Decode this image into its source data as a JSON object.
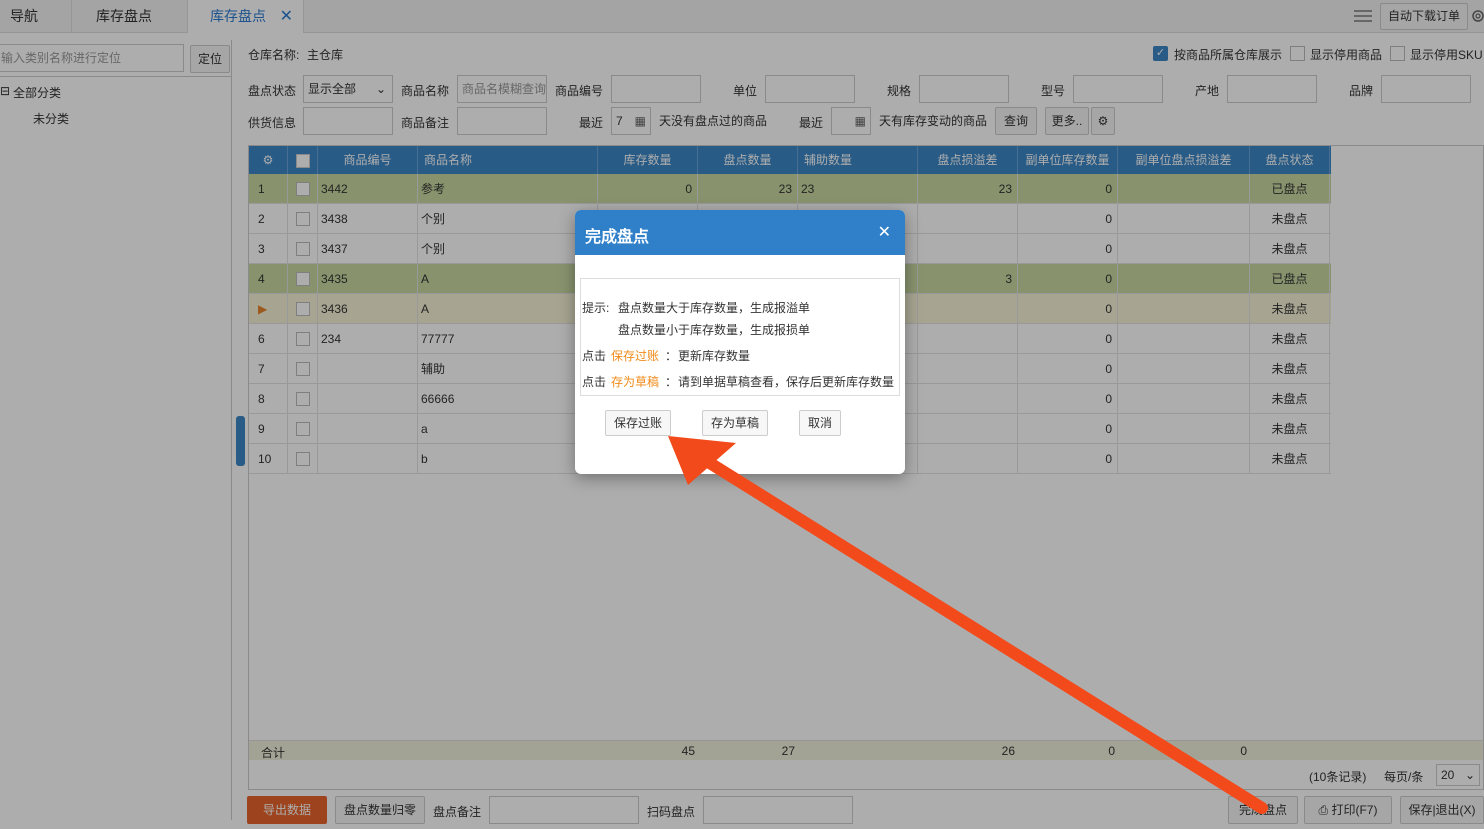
{
  "tabs": {
    "nav": "导航",
    "stock_check": "库存盘点",
    "stock_check_active": "库存盘点",
    "close": "✕"
  },
  "topright": {
    "auto_download": "自动下载订单"
  },
  "left": {
    "search_placeholder": "输入类别名称进行定位",
    "locate_btn": "定位",
    "all_category": "全部分类",
    "uncategorized": "未分类",
    "tree_toggle": "⊟"
  },
  "filters": {
    "warehouse_label": "仓库名称:",
    "warehouse_value": "主仓库",
    "chk_by_warehouse": "按商品所属仓库展示",
    "chk_show_disabled_goods": "显示停用商品",
    "chk_show_disabled_sku": "显示停用SKU",
    "status_label": "盘点状态",
    "status_value": "显示全部",
    "name_label": "商品名称",
    "name_placeholder": "商品名模糊查询",
    "code_label": "商品编号",
    "unit_label": "单位",
    "spec_label": "规格",
    "model_label": "型号",
    "origin_label": "产地",
    "brand_label": "品牌",
    "supply_label": "供货信息",
    "remark_label": "商品备注",
    "recent_label": "最近",
    "recent_days": "7",
    "no_check_text": "天没有盘点过的商品",
    "recent2_label": "最近",
    "stock_change_text": "天有库存变动的商品",
    "query_btn": "查询",
    "more_btn": "更多.."
  },
  "grid": {
    "headers": [
      "商品编号",
      "商品名称",
      "库存数量",
      "盘点数量",
      "辅助数量",
      "盘点损溢差",
      "副单位库存数量",
      "副单位盘点损溢差",
      "盘点状态"
    ],
    "rows": [
      {
        "idx": "1",
        "code": "3442",
        "name": "参考",
        "stock": "0",
        "check": "23",
        "aux": "23",
        "diff": "23",
        "sub_stock": "0",
        "sub_diff": "",
        "status": "已盘点",
        "hl": "green"
      },
      {
        "idx": "2",
        "code": "3438",
        "name": "个别",
        "stock": "",
        "check": "",
        "aux": "",
        "diff": "",
        "sub_stock": "0",
        "sub_diff": "",
        "status": "未盘点",
        "hl": ""
      },
      {
        "idx": "3",
        "code": "3437",
        "name": "个别",
        "stock": "",
        "check": "",
        "aux": "",
        "diff": "",
        "sub_stock": "0",
        "sub_diff": "",
        "status": "未盘点",
        "hl": ""
      },
      {
        "idx": "4",
        "code": "3435",
        "name": "A",
        "stock": "",
        "check": "",
        "aux": "",
        "diff": "3",
        "sub_stock": "0",
        "sub_diff": "",
        "status": "已盘点",
        "hl": "green"
      },
      {
        "idx": "▶",
        "code": "3436",
        "name": "A",
        "stock": "",
        "check": "",
        "aux": "",
        "diff": "",
        "sub_stock": "0",
        "sub_diff": "",
        "status": "未盘点",
        "hl": "yellow"
      },
      {
        "idx": "6",
        "code": "234",
        "name": "77777",
        "stock": "",
        "check": "",
        "aux": "",
        "diff": "",
        "sub_stock": "0",
        "sub_diff": "",
        "status": "未盘点",
        "hl": ""
      },
      {
        "idx": "7",
        "code": "",
        "name": "辅助",
        "stock": "",
        "check": "",
        "aux": "",
        "diff": "",
        "sub_stock": "0",
        "sub_diff": "",
        "status": "未盘点",
        "hl": ""
      },
      {
        "idx": "8",
        "code": "",
        "name": "66666",
        "stock": "",
        "check": "",
        "aux": "",
        "diff": "",
        "sub_stock": "0",
        "sub_diff": "",
        "status": "未盘点",
        "hl": ""
      },
      {
        "idx": "9",
        "code": "",
        "name": "a",
        "stock": "",
        "check": "",
        "aux": "",
        "diff": "",
        "sub_stock": "0",
        "sub_diff": "",
        "status": "未盘点",
        "hl": ""
      },
      {
        "idx": "10",
        "code": "",
        "name": "b",
        "stock": "",
        "check": "",
        "aux": "",
        "diff": "",
        "sub_stock": "0",
        "sub_diff": "",
        "status": "未盘点",
        "hl": ""
      }
    ],
    "total_label": "合计",
    "total_stock": "45",
    "total_check": "27",
    "total_diff": "26",
    "total_sub_stock": "0",
    "total_sub_diff": "0",
    "records": "(10条记录)",
    "per_page_label": "每页/条",
    "per_page": "20"
  },
  "bottom": {
    "export_btn": "导出数据",
    "zero_btn": "盘点数量归零",
    "remark_label": "盘点备注",
    "scan_label": "扫码盘点",
    "finish_btn": "完成盘点",
    "print_btn": "打印(F7)",
    "save_exit_btn": "保存|退出(X)"
  },
  "dialog": {
    "title": "完成盘点",
    "close": "✕",
    "tip_prefix": "提示:",
    "tip1": "盘点数量大于库存数量，生成报溢单",
    "tip2": "盘点数量小于库存数量，生成报损单",
    "click1": "点击",
    "save_post": "保存过账",
    "colon1": "：",
    "desc1": "更新库存数量",
    "click2": "点击",
    "save_draft": "存为草稿",
    "colon2": "：",
    "desc2": "请到单据草稿查看，保存后更新库存数量",
    "btn_post": "保存过账",
    "btn_draft": "存为草稿",
    "btn_cancel": "取消"
  },
  "colors": {
    "header_blue": "#3c86c6",
    "dialog_blue": "#2f80c9",
    "export_orange": "#e8652f",
    "arrow": "#f24a1a",
    "row_green": "#c9d9a3",
    "row_yellow": "#f7f3d6",
    "highlight_orange": "#f08b1a"
  }
}
